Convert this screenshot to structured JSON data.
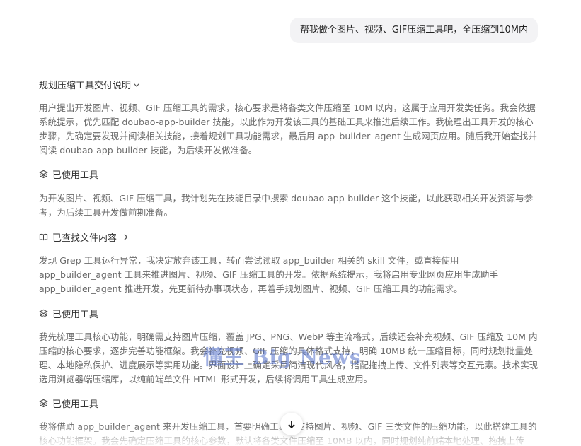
{
  "user_message": "帮我做个图片、视频、GIF压缩工具吧，全压缩到10M内",
  "plan_header": {
    "label": "规划压缩工具交付说明",
    "icon": "chevron-down-icon"
  },
  "paragraphs": [
    "用户提出开发图片、视频、GIF 压缩工具的需求，核心要求是将各类文件压缩至 10M 以内，这属于应用开发类任务。我会依据系统提示，优先匹配 doubao-app-builder 技能，以此作为开发该工具的基础工具来推进后续工作。我梳理出工具开发的核心步骤，先确定要发现并阅读相关技能，接着规划工具功能需求，最后用 app_builder_agent 生成网页应用。随后我开始查找并阅读 doubao-app-builder 技能，为后续开发做准备。",
    "为开发图片、视频、GIF 压缩工具，我计划先在技能目录中搜索 doubao-app-builder 这个技能，以此获取相关开发资源与参考，为后续工具开发做前期准备。",
    "发现 Grep 工具运行异常，我决定放弃该工具，转而尝试读取 app_builder 相关的 skill 文件，或直接使用 app_builder_agent 工具来推进图片、视频、GIF 压缩工具的开发。依据系统提示，我将启用专业网页应用生成助手 app_builder_agent 推进开发，先更新待办事项状态，再着手规划图片、视频、GIF 压缩工具的功能需求。",
    "我先梳理工具核心功能，明确需支持图片压缩，覆盖 JPG、PNG、WebP 等主流格式，后续还会补充视频、GIF 压缩及 10M 内压缩的核心要求，逐步完善功能框架。我会补充视频、GIF 压缩的具体格式支持，明确 10MB 统一压缩目标，同时规划批量处理、本地隐私保护、进度展示等实用功能。界面设计上确定采用简洁现代风格，搭配拖拽上传、文件列表等交互元素。技术实现选用浏览器端压缩库，以纯前端单文件 HTML 形式开发，后续将调用工具生成应用。",
    "我将借助 app_builder_agent 来开发压缩工具，首要明确工具需支持图片、视频、GIF 三类文件的压缩功能，以此搭建工具的核心功能框架。我会先确定压缩工具的核心参数，默认将各类文件压缩至 10MB 以内，同时规划纯前端本地处理、拖拽上传"
  ],
  "tool_rows": [
    {
      "label": "已使用工具",
      "icon": "layers-icon"
    },
    {
      "label": "已查找文件内容",
      "icon": "book-open-icon",
      "chevron": "chevron-right-icon"
    },
    {
      "label": "已使用工具",
      "icon": "layers-icon"
    },
    {
      "label": "已使用工具",
      "icon": "layers-icon"
    }
  ],
  "watermark_text": "懂王 Big News",
  "scroll_button": {
    "icon": "arrow-down-icon"
  }
}
